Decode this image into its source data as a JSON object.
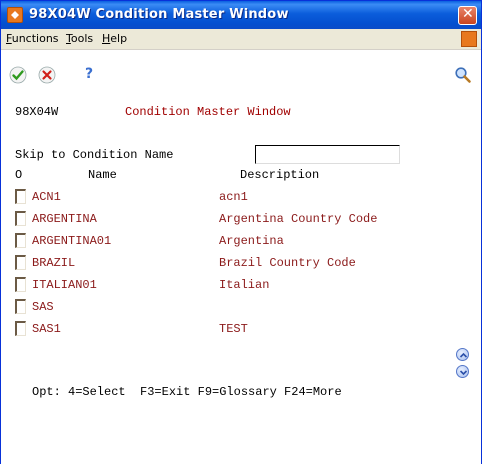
{
  "window": {
    "title": "98X04W   Condition Master Window"
  },
  "menubar": {
    "items": [
      {
        "label": "Functions",
        "mnemonic": "F"
      },
      {
        "label": "Tools",
        "mnemonic": "T"
      },
      {
        "label": "Help",
        "mnemonic": "H"
      }
    ]
  },
  "toolbar": {
    "buttons": [
      "ok-check-icon",
      "cancel-x-icon",
      "help-question-icon",
      "search-magnifier-icon"
    ],
    "help_glyph": "?"
  },
  "form": {
    "program_id": "98X04W",
    "form_title": "Condition Master Window",
    "skip_label": "Skip to Condition Name",
    "skip_value": "",
    "col_option": "O",
    "col_name": "Name",
    "col_description": "Description"
  },
  "rows": [
    {
      "name": "ACN1",
      "description": "acn1"
    },
    {
      "name": "ARGENTINA",
      "description": "Argentina Country Code"
    },
    {
      "name": "ARGENTINA01",
      "description": "Argentina"
    },
    {
      "name": "BRAZIL",
      "description": "Brazil Country Code"
    },
    {
      "name": "ITALIAN01",
      "description": "Italian"
    },
    {
      "name": "SAS",
      "description": ""
    },
    {
      "name": "SAS1",
      "description": "TEST"
    }
  ],
  "footer": {
    "options": "Opt: 4=Select  F3=Exit F9=Glossary F24=More"
  },
  "colors": {
    "title_bar": "#0a5fe0",
    "red_text": "#a00000",
    "data_text": "#8b1a1a"
  }
}
